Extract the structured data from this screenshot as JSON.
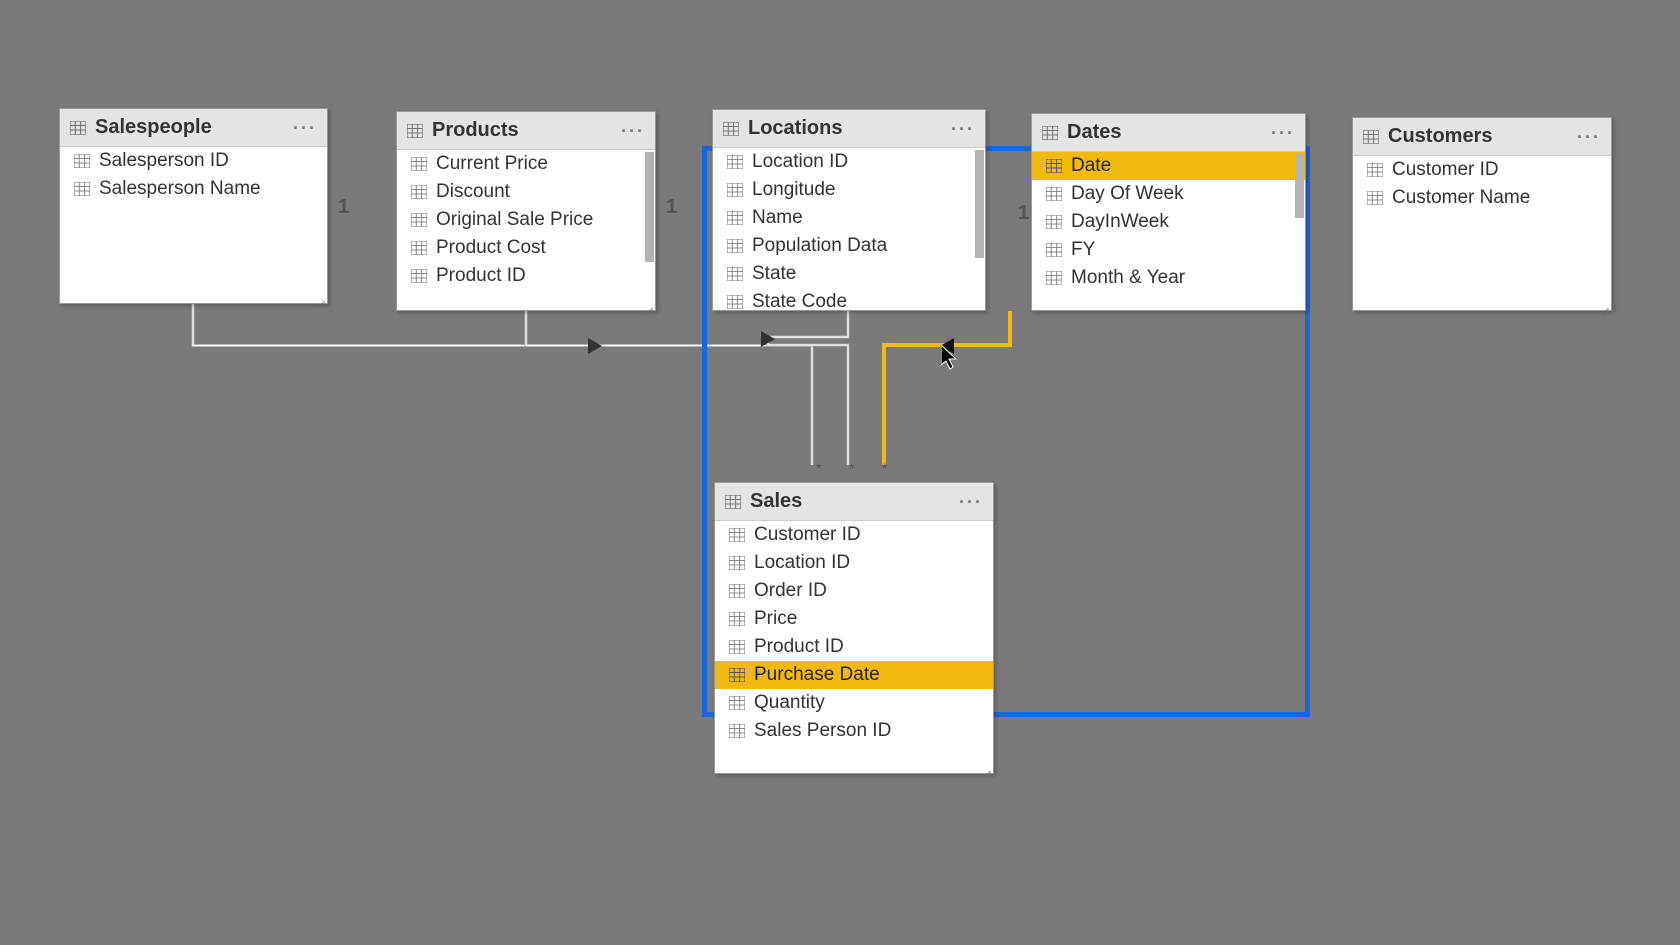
{
  "tables": {
    "salespeople": {
      "title": "Salespeople",
      "fields": [
        "Salesperson ID",
        "Salesperson Name"
      ]
    },
    "products": {
      "title": "Products",
      "fields": [
        "Current Price",
        "Discount",
        "Original Sale Price",
        "Product Cost",
        "Product ID"
      ]
    },
    "locations": {
      "title": "Locations",
      "fields": [
        "Location ID",
        "Longitude",
        "Name",
        "Population Data",
        "State",
        "State Code"
      ]
    },
    "dates": {
      "title": "Dates",
      "fields": [
        "Date",
        "Day Of Week",
        "DayInWeek",
        "FY",
        "Month & Year"
      ],
      "highlight_index": 0
    },
    "customers": {
      "title": "Customers",
      "fields": [
        "Customer ID",
        "Customer Name"
      ]
    },
    "sales": {
      "title": "Sales",
      "fields": [
        "Customer ID",
        "Location ID",
        "Order ID",
        "Price",
        "Product ID",
        "Purchase Date",
        "Quantity",
        "Sales Person ID"
      ],
      "highlight_index": 5
    }
  },
  "cardinality": {
    "salespeople": "1",
    "products": "1",
    "dates": "1",
    "sales_asterisks": "* * *"
  },
  "menu_dots": "···"
}
